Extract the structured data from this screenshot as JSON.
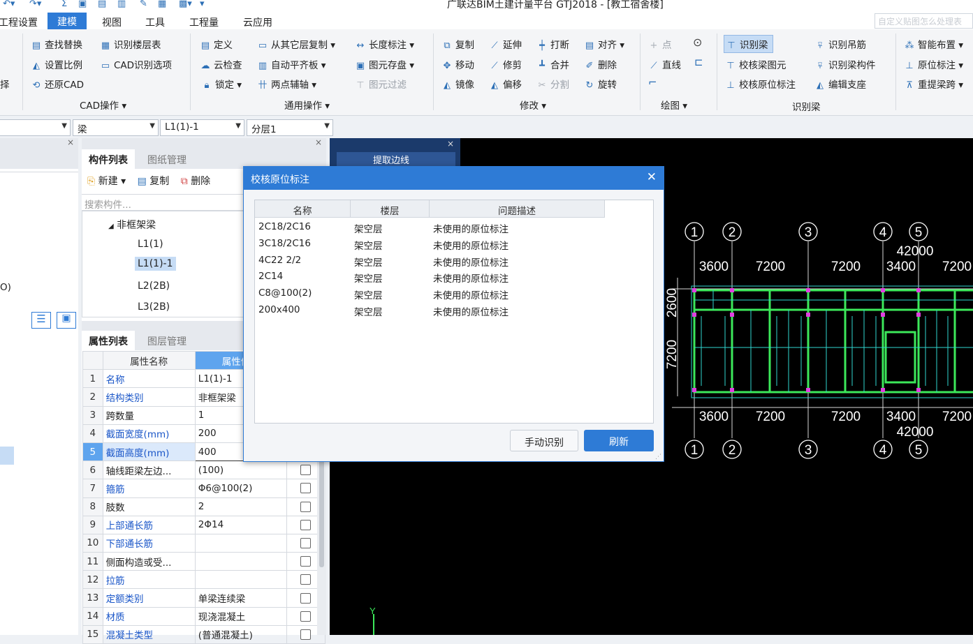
{
  "app": {
    "title": "广联达BIM土建计量平台 GTJ2018 - [教工宿舍楼]",
    "help_placeholder": "自定义贴图怎么处理表"
  },
  "menu": [
    "工程设置",
    "建模",
    "视图",
    "工具",
    "工程量",
    "云应用"
  ],
  "ribbon": {
    "cad_ops": {
      "label": "CAD操作",
      "items": [
        "查找替换",
        "识别楼层表",
        "设置比例",
        "CAD识别选项",
        "还原CAD"
      ]
    },
    "general_ops": {
      "label": "通用操作",
      "items": [
        "定义",
        "从其它层复制",
        "长度标注",
        "云检查",
        "自动平齐板",
        "图元存盘",
        "锁定",
        "两点辅轴",
        "图元过滤"
      ]
    },
    "modify": {
      "label": "修改",
      "items": [
        "复制",
        "延伸",
        "打断",
        "对齐",
        "移动",
        "修剪",
        "合并",
        "删除",
        "镜像",
        "偏移",
        "分割",
        "旋转"
      ]
    },
    "draw": {
      "label": "绘图",
      "items": [
        "点",
        "直线"
      ]
    },
    "recognize_beam": {
      "label": "识别梁",
      "items": [
        "识别梁",
        "识别吊筋",
        "校核梁图元",
        "识别梁构件",
        "校核原位标注",
        "编辑支座"
      ]
    },
    "extra": {
      "items": [
        "智能布置",
        "原位标注",
        "重提梁跨"
      ]
    },
    "left_cut": [
      "择"
    ]
  },
  "selectors": {
    "s2": "梁",
    "s3": "L1(1)-1",
    "s4": "分层1"
  },
  "left_strip": {
    "cut_text": "O)"
  },
  "component_panel": {
    "tabs": [
      "构件列表",
      "图纸管理"
    ],
    "toolbar": [
      "新建",
      "复制",
      "删除"
    ],
    "search_placeholder": "搜索构件...",
    "tree_group": "非框架梁",
    "tree_items": [
      "L1(1)",
      "L1(1)-1",
      "L2(2B)",
      "L3(2B)"
    ]
  },
  "property_panel": {
    "tabs": [
      "属性列表",
      "图层管理"
    ],
    "headers": [
      "属性名称",
      "属性值"
    ],
    "rows": [
      {
        "n": "1",
        "k": "名称",
        "v": "L1(1)-1"
      },
      {
        "n": "2",
        "k": "结构类别",
        "v": "非框架梁"
      },
      {
        "n": "3",
        "k": "跨数量",
        "v": "1"
      },
      {
        "n": "4",
        "k": "截面宽度(mm)",
        "v": "200"
      },
      {
        "n": "5",
        "k": "截面高度(mm)",
        "v": "400"
      },
      {
        "n": "6",
        "k": "轴线距梁左边...",
        "v": "(100)"
      },
      {
        "n": "7",
        "k": "箍筋",
        "v": "Φ6@100(2)"
      },
      {
        "n": "8",
        "k": "肢数",
        "v": "2"
      },
      {
        "n": "9",
        "k": "上部通长筋",
        "v": "2Φ14"
      },
      {
        "n": "10",
        "k": "下部通长筋",
        "v": ""
      },
      {
        "n": "11",
        "k": "侧面构造或受...",
        "v": ""
      },
      {
        "n": "12",
        "k": "拉筋",
        "v": ""
      },
      {
        "n": "13",
        "k": "定额类别",
        "v": "单梁连续梁"
      },
      {
        "n": "14",
        "k": "材质",
        "v": "现浇混凝土"
      },
      {
        "n": "15",
        "k": "混凝土类型",
        "v": "(普通混凝土)"
      }
    ]
  },
  "canvas_panel": {
    "header": "提取边线"
  },
  "dialog": {
    "title": "校核原位标注",
    "columns": [
      "名称",
      "楼层",
      "问题描述"
    ],
    "rows": [
      {
        "name": "2C18/2C16",
        "floor": "架空层",
        "desc": "未使用的原位标注"
      },
      {
        "name": "3C18/2C16",
        "floor": "架空层",
        "desc": "未使用的原位标注"
      },
      {
        "name": "4C22 2/2",
        "floor": "架空层",
        "desc": "未使用的原位标注"
      },
      {
        "name": "2C14",
        "floor": "架空层",
        "desc": "未使用的原位标注"
      },
      {
        "name": "C8@100(2)",
        "floor": "架空层",
        "desc": "未使用的原位标注"
      },
      {
        "name": "200x400",
        "floor": "架空层",
        "desc": "未使用的原位标注"
      }
    ],
    "btn_manual": "手动识别",
    "btn_refresh": "刷新"
  },
  "drawing": {
    "axes": [
      "1",
      "2",
      "3",
      "4",
      "5"
    ],
    "total": "42000",
    "top_dims": [
      "3600",
      "7200",
      "7200",
      "3400",
      "7200"
    ],
    "bottom_dims": [
      "3600",
      "7200",
      "7200",
      "3400",
      "7200"
    ],
    "left_dims": [
      "2600",
      "7200"
    ],
    "y_axis_label": "Y"
  },
  "colors": {
    "accent": "#2e7bd6",
    "cad_green": "#3ce85a",
    "cad_cyan": "#2fd6d0",
    "column_magenta": "#e040e0"
  }
}
